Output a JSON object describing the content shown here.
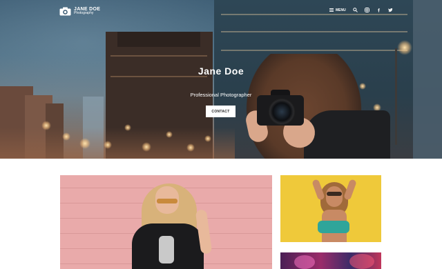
{
  "brand": {
    "name": "JANE DOE",
    "tagline": "Photography"
  },
  "nav": {
    "menu_label": "MENU",
    "icons": [
      "search-icon",
      "instagram-icon",
      "facebook-icon",
      "twitter-icon"
    ]
  },
  "hero": {
    "title": "Jane Doe",
    "subtitle": "Professional Photographer",
    "cta_label": "CONTACT"
  },
  "colors": {
    "hero_overlay": "#3d5d74",
    "button_bg": "#ffffff",
    "button_text": "#222222",
    "photo_pink_wall": "#e9aaaa",
    "photo_yellow_wall": "#efc93a"
  },
  "gallery": {
    "items": [
      {
        "subject": "woman-pink-wall"
      },
      {
        "subject": "woman-yellow-wall"
      },
      {
        "subject": "neon-lights"
      }
    ]
  }
}
